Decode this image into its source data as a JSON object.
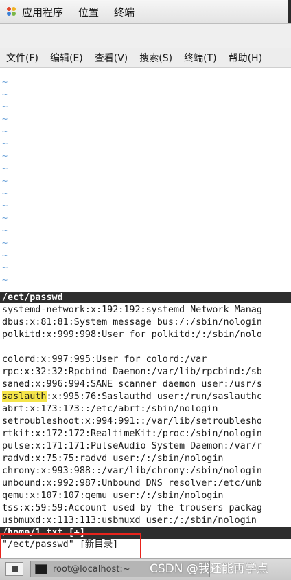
{
  "top_panel": {
    "applications": "应用程序",
    "places": "位置",
    "terminal": "终端"
  },
  "menubar": {
    "items": [
      "文件(F)",
      "编辑(E)",
      "查看(V)",
      "搜索(S)",
      "终端(T)",
      "帮助(H)"
    ]
  },
  "editor": {
    "tilde": "~",
    "top_status": "/ect/passwd",
    "lines": [
      "systemd-network:x:192:192:systemd Network Manag",
      "dbus:x:81:81:System message bus:/:/sbin/nologin",
      "polkitd:x:999:998:User for polkitd:/:/sbin/nolo",
      "",
      "colord:x:997:995:User for colord:/var",
      "rpc:x:32:32:Rpcbind Daemon:/var/lib/rpcbind:/sb",
      "saned:x:996:994:SANE scanner daemon user:/usr/s",
      "saslauth:x:995:76:Saslauthd user:/run/saslauthc",
      "abrt:x:173:173::/etc/abrt:/sbin/nologin",
      "setroubleshoot:x:994:991::/var/lib/setroublesho",
      "rtkit:x:172:172:RealtimeKit:/proc:/sbin/nologin",
      "pulse:x:171:171:PulseAudio System Daemon:/var/r",
      "radvd:x:75:75:radvd user:/:/sbin/nologin",
      "chrony:x:993:988::/var/lib/chrony:/sbin/nologin",
      "unbound:x:992:987:Unbound DNS resolver:/etc/unb",
      "qemu:x:107:107:qemu user:/:/sbin/nologin",
      "tss:x:59:59:Account used by the trousers packag",
      "usbmuxd:x:113:113:usbmuxd user:/:/sbin/nologin"
    ],
    "highlight_word": "saslauth",
    "highlight_rest": ":x:995:76:Saslauthd user:/run/saslauthc",
    "bottom_status": "/home/1.txt [+]",
    "command_line": "\"/ect/passwd\" [新目录]"
  },
  "taskbar": {
    "task_label": "root@localhost:~",
    "watermark": "CSDN @我还能再学点"
  },
  "colors": {
    "status_bar": "#2e2e2e",
    "search_highlight": "#f5e54a",
    "tilde": "#6aa1d8",
    "annotation_box": "#e8231b"
  }
}
